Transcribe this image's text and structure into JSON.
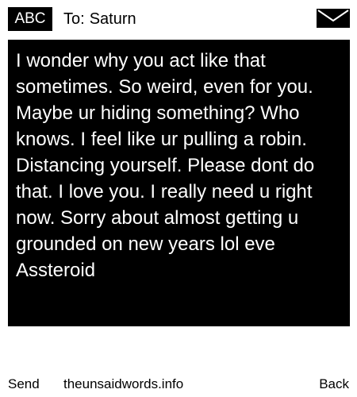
{
  "header": {
    "input_mode": "ABC",
    "recipient_prefix": "To:",
    "recipient_name": "Saturn",
    "envelope_icon": "envelope-icon"
  },
  "message": {
    "text": "I wonder why you act like that sometimes. So weird, even for you. Maybe ur hiding something? Who knows. I feel like ur pulling a robin. Distancing yourself. Please dont do that. I love you. I really need u right now. Sorry about almost getting u grounded on new years lol eve Assteroid"
  },
  "footer": {
    "send_label": "Send",
    "site_label": "theunsaidwords.info",
    "back_label": "Back"
  },
  "colors": {
    "background": "#ffffff",
    "message_box": "#000000",
    "message_text": "#ffffff",
    "text": "#000000"
  }
}
